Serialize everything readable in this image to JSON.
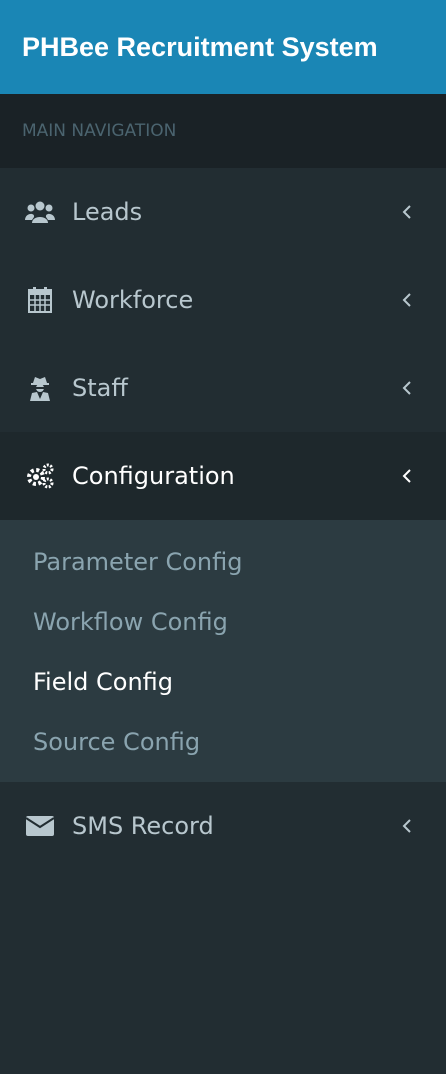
{
  "app": {
    "title": "PHBee Recruitment System"
  },
  "nav": {
    "header": "MAIN NAVIGATION",
    "items": [
      {
        "label": "Leads",
        "icon": "users-icon"
      },
      {
        "label": "Workforce",
        "icon": "calendar-icon"
      },
      {
        "label": "Staff",
        "icon": "user-secret-icon"
      },
      {
        "label": "Configuration",
        "icon": "cogs-icon",
        "active": true,
        "children": [
          {
            "label": "Parameter Config"
          },
          {
            "label": "Workflow Config"
          },
          {
            "label": "Field Config",
            "active": true
          },
          {
            "label": "Source Config"
          }
        ]
      },
      {
        "label": "SMS Record",
        "icon": "envelope-icon"
      }
    ]
  },
  "colors": {
    "header_bg": "#1a86b5",
    "sidebar_bg": "#222d32",
    "nav_header_bg": "#1a2226",
    "active_bg": "#1e282c",
    "submenu_bg": "#2c3b41",
    "text_muted": "#b8c7ce",
    "submenu_text": "#8aa4af"
  }
}
